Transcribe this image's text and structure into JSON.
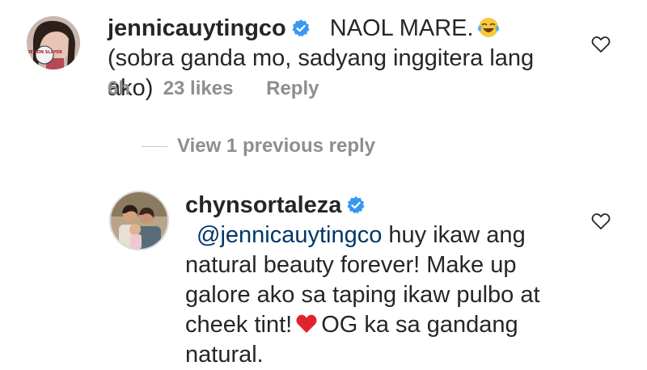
{
  "comments": [
    {
      "username": "jennicauytingco",
      "text_part1": "NAOL MARE.",
      "emoji": "face-with-tears-of-joy",
      "text_part2": "(sobra ganda mo, sadyang inggitera lang ako)",
      "time": "6h",
      "likes": "23 likes",
      "reply_label": "Reply",
      "avatar_badge": "DEMON SLAYER"
    },
    {
      "username": "chynsortaleza",
      "mention": "@jennicauytingco",
      "text_part1": "huy ikaw ang natural beauty forever! Make up galore ako sa taping ikaw pulbo at cheek tint!",
      "emoji": "red-heart",
      "text_part2": "OG ka sa gandang natural."
    }
  ],
  "view_replies": "View 1 previous reply",
  "icons": {
    "verified": "verified-badge-icon",
    "like": "heart-outline-icon"
  },
  "colors": {
    "text": "#262626",
    "meta": "#8e8e8e",
    "mention": "#00376b",
    "verified": "#3897f0"
  }
}
